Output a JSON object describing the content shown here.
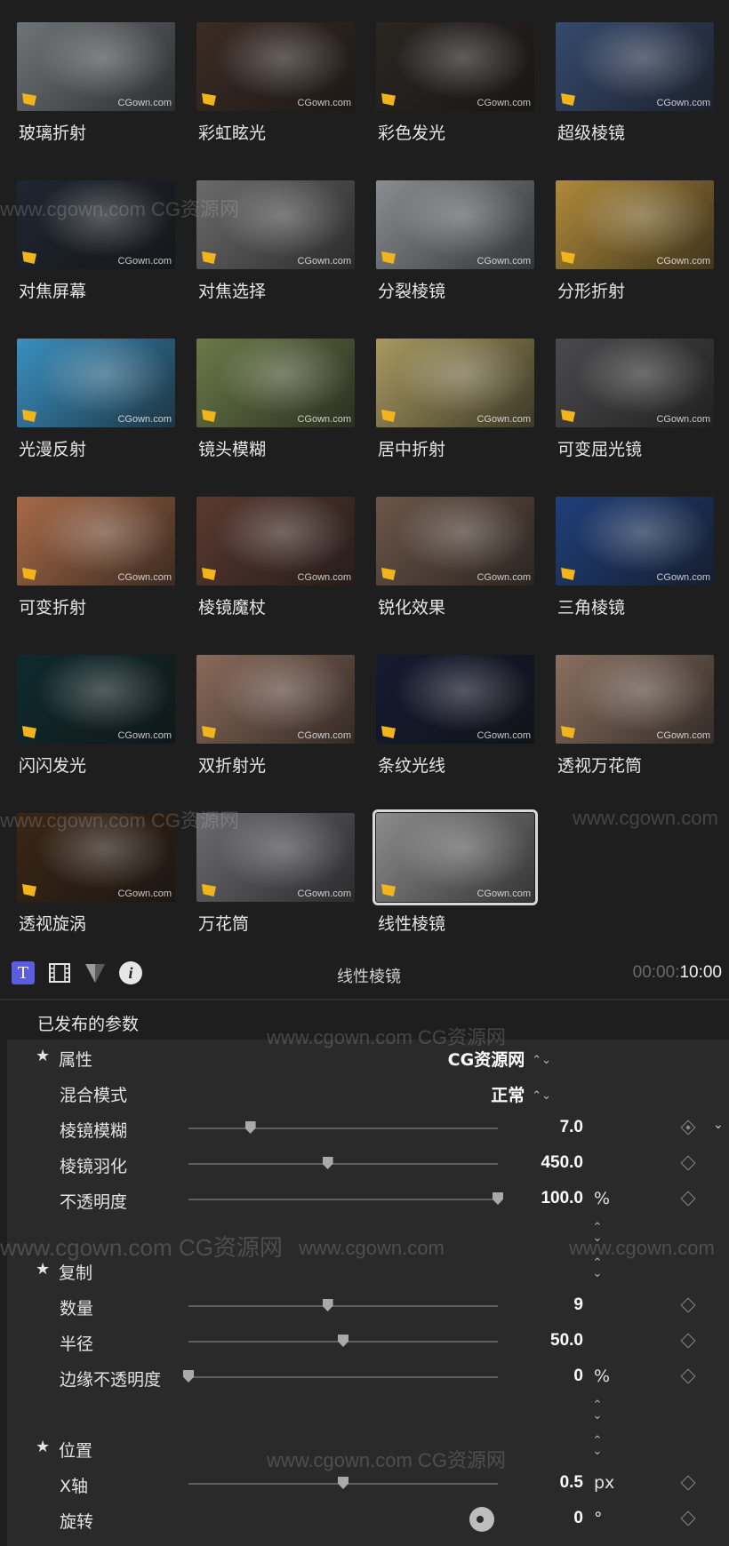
{
  "browser": {
    "effects": [
      {
        "label": "玻璃折射",
        "thumb": "#6f7478",
        "watermark": "CGown.com",
        "thumb_desc": "couple-street"
      },
      {
        "label": "彩虹眩光",
        "thumb": "#3b2c24",
        "watermark": "CGown.com",
        "thumb_desc": "couple-sparkler"
      },
      {
        "label": "彩色发光",
        "thumb": "#2a2622",
        "watermark": "CGown.com",
        "thumb_desc": "stadium-lights"
      },
      {
        "label": "超级棱镜",
        "thumb": "#364a6e",
        "watermark": "CGown.com",
        "thumb_desc": "woman-kaleidoscope"
      },
      {
        "label": "对焦屏幕",
        "thumb": "#1f2630",
        "watermark": "CGown.com",
        "thumb_desc": "bearded-man"
      },
      {
        "label": "对焦选择",
        "thumb": "#6b6b6b",
        "watermark": "CGown.com",
        "thumb_desc": "branches-bw"
      },
      {
        "label": "分裂棱镜",
        "thumb": "#8a8d91",
        "watermark": "CGown.com",
        "thumb_desc": "man-hat"
      },
      {
        "label": "分形折射",
        "thumb": "#b08a3a",
        "watermark": "CGown.com",
        "thumb_desc": "woman-field"
      },
      {
        "label": "光漫反射",
        "thumb": "#3a8fc0",
        "watermark": "CGown.com",
        "thumb_desc": "girl-blue"
      },
      {
        "label": "镜头模糊",
        "thumb": "#6a7a48",
        "watermark": "CGown.com",
        "thumb_desc": "woman-forest"
      },
      {
        "label": "居中折射",
        "thumb": "#a89a60",
        "watermark": "CGown.com",
        "thumb_desc": "singer"
      },
      {
        "label": "可变屈光镜",
        "thumb": "#4a4a4c",
        "watermark": "CGown.com",
        "thumb_desc": "woman-leather"
      },
      {
        "label": "可变折射",
        "thumb": "#a86a48",
        "watermark": "CGown.com",
        "thumb_desc": "redhead"
      },
      {
        "label": "棱镜魔杖",
        "thumb": "#5a3a30",
        "watermark": "CGown.com",
        "thumb_desc": "biker"
      },
      {
        "label": "锐化效果",
        "thumb": "#6b5648",
        "watermark": "CGown.com",
        "thumb_desc": "man-glasses"
      },
      {
        "label": "三角棱镜",
        "thumb": "#1f3f7a",
        "watermark": "CGown.com",
        "thumb_desc": "dancer-blue"
      },
      {
        "label": "闪闪发光",
        "thumb": "#0f2a2e",
        "watermark": "CGown.com",
        "thumb_desc": "car-grille"
      },
      {
        "label": "双折射光",
        "thumb": "#8a6a5a",
        "watermark": "CGown.com",
        "thumb_desc": "city-sunset"
      },
      {
        "label": "条纹光线",
        "thumb": "#151a30",
        "watermark": "CGown.com",
        "thumb_desc": "boxer"
      },
      {
        "label": "透视万花筒",
        "thumb": "#8a7060",
        "watermark": "CGown.com",
        "thumb_desc": "woman-sunglasses"
      },
      {
        "label": "透视旋涡",
        "thumb": "#3a2616",
        "watermark": "CGown.com",
        "thumb_desc": "tunnel-swirl"
      },
      {
        "label": "万花筒",
        "thumb": "#6c6c70",
        "watermark": "CGown.com",
        "thumb_desc": "kaleidoscope"
      },
      {
        "label": "线性棱镜",
        "thumb": "#8c8c8c",
        "watermark": "CGown.com",
        "thumb_desc": "linear-prism-bw",
        "selected": true
      }
    ]
  },
  "inspector": {
    "title_icon": "T",
    "info_icon": "i",
    "clip_name": "线性棱镜",
    "timecode_dim": "00:00:",
    "timecode_bright": "10:00",
    "panel_title": "已发布的参数"
  },
  "params": {
    "groups": [
      {
        "key": "attrs",
        "label": "属性",
        "popup": "CG资源网"
      },
      {
        "key": "copy",
        "label": "复制"
      },
      {
        "key": "position",
        "label": "位置"
      }
    ],
    "blend_mode": {
      "label": "混合模式",
      "value": "正常"
    },
    "prism_blur": {
      "label": "棱镜模糊",
      "value": "7.0",
      "level": 0.2
    },
    "prism_feather": {
      "label": "棱镜羽化",
      "value": "450.0",
      "level": 0.45
    },
    "opacity": {
      "label": "不透明度",
      "value": "100.0",
      "unit": "%",
      "level": 1.0
    },
    "count": {
      "label": "数量",
      "value": "9",
      "level": 0.45
    },
    "radius": {
      "label": "半径",
      "value": "50.0",
      "level": 0.5
    },
    "edge_opacity": {
      "label": "边缘不透明度",
      "value": "0",
      "unit": "%",
      "level": 0.0
    },
    "x_axis": {
      "label": "X轴",
      "value": "0.5",
      "unit": "px",
      "level": 0.5
    },
    "rotation": {
      "label": "旋转",
      "value": "0",
      "unit": "°"
    }
  },
  "watermarks": {
    "url": "www.cgown.com",
    "cn": "CG资源网",
    "url_cn": "www.cgown.com CG资源网"
  },
  "colors": {
    "accent": "#5b5ce0",
    "background": "#1e1e1f",
    "panel": "#2a2a2b"
  }
}
